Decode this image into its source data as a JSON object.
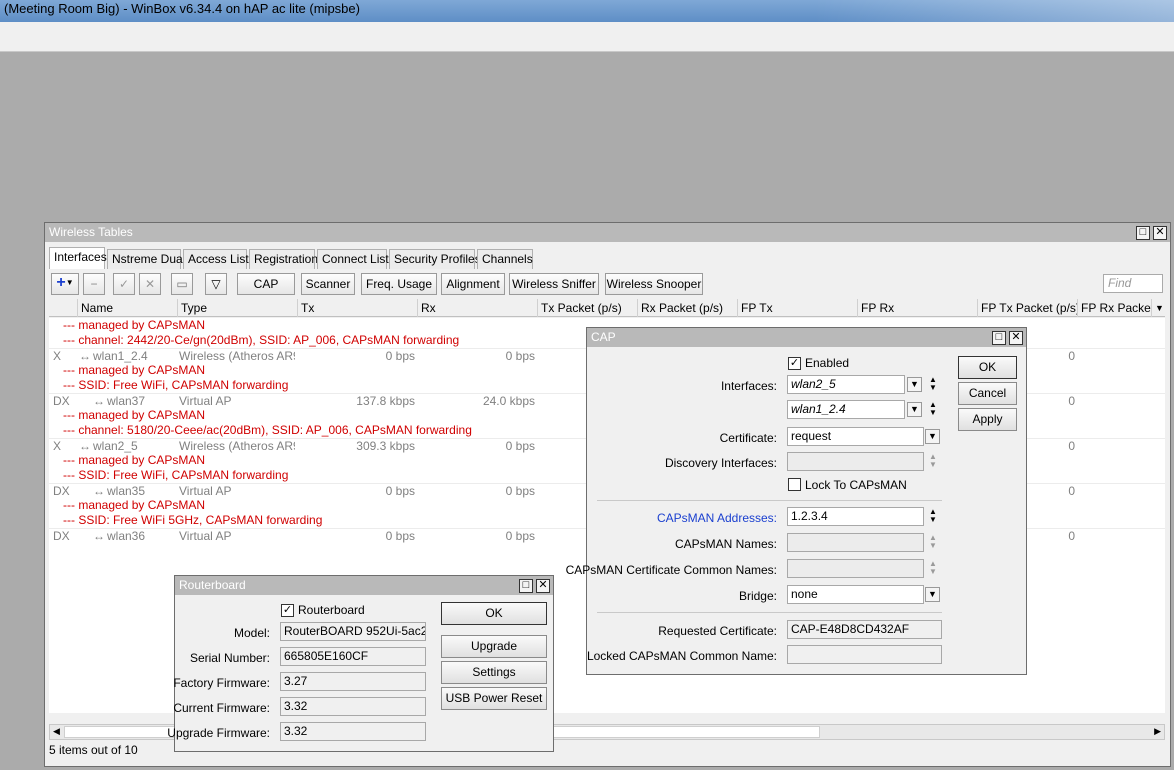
{
  "app": {
    "title": "(Meeting Room Big) - WinBox v6.34.4 on hAP ac lite (mipsbe)"
  },
  "wireless": {
    "title": "Wireless Tables",
    "tabs": [
      "Interfaces",
      "Nstreme Dual",
      "Access List",
      "Registration",
      "Connect List",
      "Security Profiles",
      "Channels"
    ],
    "toolbar": {
      "cap": "CAP",
      "scanner": "Scanner",
      "freq_usage": "Freq. Usage",
      "alignment": "Alignment",
      "sniffer": "Wireless Sniffer",
      "snooper": "Wireless Snooper",
      "find_placeholder": "Find"
    },
    "columns": [
      "Name",
      "Type",
      "Tx",
      "Rx",
      "Tx Packet (p/s)",
      "Rx Packet (p/s)",
      "FP Tx",
      "FP Rx",
      "FP Tx Packet (p/s)",
      "FP Rx Packet"
    ],
    "rows": [
      {
        "kind": "comment",
        "text": "--- managed by CAPsMAN"
      },
      {
        "kind": "comment",
        "text": "--- channel: 2442/20-Ce/gn(20dBm), SSID: AP_006, CAPsMAN forwarding"
      },
      {
        "kind": "data",
        "flag": "X",
        "name": "wlan1_2.4",
        "type": "Wireless (Atheros AR9...",
        "tx": "0 bps",
        "rx": "0 bps",
        "fp_rx_packet": "0"
      },
      {
        "kind": "comment",
        "text": "--- managed by CAPsMAN"
      },
      {
        "kind": "comment",
        "text": "--- SSID: Free WiFi, CAPsMAN forwarding"
      },
      {
        "kind": "data",
        "flag": "DX",
        "name": "wlan37",
        "type": "Virtual AP",
        "tx": "137.8 kbps",
        "rx": "24.0 kbps",
        "fp_rx_packet": "0"
      },
      {
        "kind": "comment",
        "text": "--- managed by CAPsMAN"
      },
      {
        "kind": "comment",
        "text": "--- channel: 5180/20-Ceee/ac(20dBm), SSID: AP_006, CAPsMAN forwarding"
      },
      {
        "kind": "data",
        "flag": "X",
        "name": "wlan2_5",
        "type": "Wireless (Atheros AR9...",
        "tx": "309.3 kbps",
        "rx": "0 bps",
        "fp_rx_packet": "0"
      },
      {
        "kind": "comment",
        "text": "--- managed by CAPsMAN"
      },
      {
        "kind": "comment",
        "text": "--- SSID: Free WiFi, CAPsMAN forwarding"
      },
      {
        "kind": "data",
        "flag": "DX",
        "name": "wlan35",
        "type": "Virtual AP",
        "tx": "0 bps",
        "rx": "0 bps",
        "fp_rx_packet": "0"
      },
      {
        "kind": "comment",
        "text": "--- managed by CAPsMAN"
      },
      {
        "kind": "comment",
        "text": "--- SSID: Free WiFi 5GHz, CAPsMAN forwarding"
      },
      {
        "kind": "data",
        "flag": "DX",
        "name": "wlan36",
        "type": "Virtual AP",
        "tx": "0 bps",
        "rx": "0 bps",
        "fp_rx_packet": "0"
      }
    ],
    "status": "5 items out of 10"
  },
  "cap": {
    "title": "CAP",
    "enabled_label": "Enabled",
    "interfaces_label": "Interfaces:",
    "interface_1": "wlan2_5",
    "interface_2": "wlan1_2.4",
    "certificate_label": "Certificate:",
    "certificate": "request",
    "discovery_label": "Discovery Interfaces:",
    "lock_label": "Lock To CAPsMAN",
    "addresses_label": "CAPsMAN Addresses:",
    "addresses": "1.2.3.4",
    "names_label": "CAPsMAN Names:",
    "cert_common_label": "CAPsMAN Certificate Common Names:",
    "bridge_label": "Bridge:",
    "bridge": "none",
    "requested_cert_label": "Requested Certificate:",
    "requested_cert": "CAP-E48D8CD432AF",
    "locked_name_label": "Locked CAPsMAN Common Name:",
    "ok": "OK",
    "cancel": "Cancel",
    "apply": "Apply"
  },
  "routerboard": {
    "title": "Routerboard",
    "checkbox_label": "Routerboard",
    "model_label": "Model:",
    "model": "RouterBOARD 952Ui-5ac2...",
    "serial_label": "Serial Number:",
    "serial": "665805E160CF",
    "factory_label": "Factory Firmware:",
    "factory": "3.27",
    "current_label": "Current Firmware:",
    "current": "3.32",
    "upgrade_label": "Upgrade Firmware:",
    "upgrade": "3.32",
    "ok": "OK",
    "upgrade_btn": "Upgrade",
    "settings": "Settings",
    "usb": "USB Power Reset"
  }
}
